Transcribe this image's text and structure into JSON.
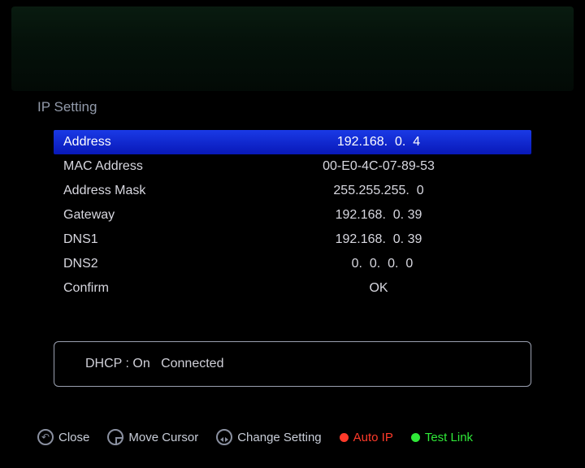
{
  "page_title": "IP Setting",
  "selected_index": 0,
  "rows": [
    {
      "label": "Address",
      "value": "192.168.  0.  4"
    },
    {
      "label": "MAC Address",
      "value": "00-E0-4C-07-89-53"
    },
    {
      "label": "Address Mask",
      "value": "255.255.255.  0"
    },
    {
      "label": "Gateway",
      "value": "192.168.  0. 39"
    },
    {
      "label": "DNS1",
      "value": "192.168.  0. 39"
    },
    {
      "label": "DNS2",
      "value": "  0.  0.  0.  0"
    },
    {
      "label": "Confirm",
      "value": "OK"
    }
  ],
  "status": {
    "dhcp_label": "DHCP :",
    "dhcp_state": "On",
    "connection": "Connected"
  },
  "footer": {
    "close": "Close",
    "move": "Move Cursor",
    "change": "Change Setting",
    "auto_ip": "Auto IP",
    "test_link": "Test Link"
  },
  "colors": {
    "red_dot": "#ff3a2a",
    "green_dot": "#2fe838"
  }
}
